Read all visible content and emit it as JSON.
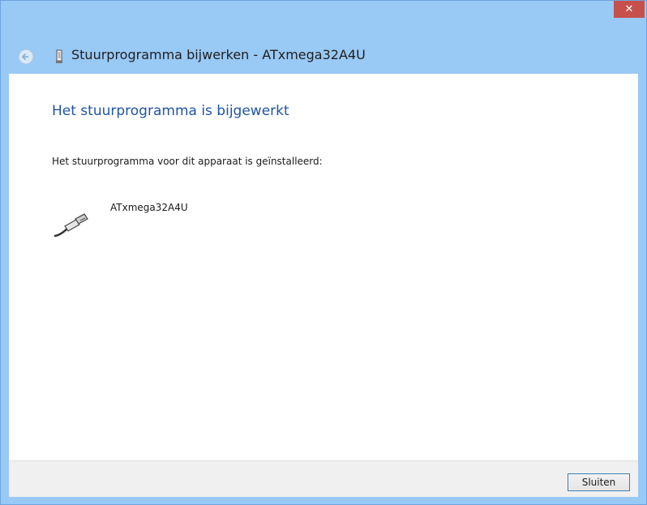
{
  "window": {
    "close_glyph": "✕",
    "title": "Stuurprogramma bijwerken - ATxmega32A4U"
  },
  "content": {
    "heading": "Het stuurprogramma is bijgewerkt",
    "description": "Het stuurprogramma voor dit apparaat is geïnstalleerd:",
    "device_name": "ATxmega32A4U"
  },
  "footer": {
    "close_button_label": "Sluiten"
  },
  "icons": {
    "back": "back-arrow-icon",
    "device": "usb-device-icon",
    "usb": "usb-plug-icon"
  },
  "colors": {
    "frame": "#99c9f5",
    "close_button": "#c7504c",
    "heading": "#1e55a9",
    "footer": "#f0f0f0"
  }
}
